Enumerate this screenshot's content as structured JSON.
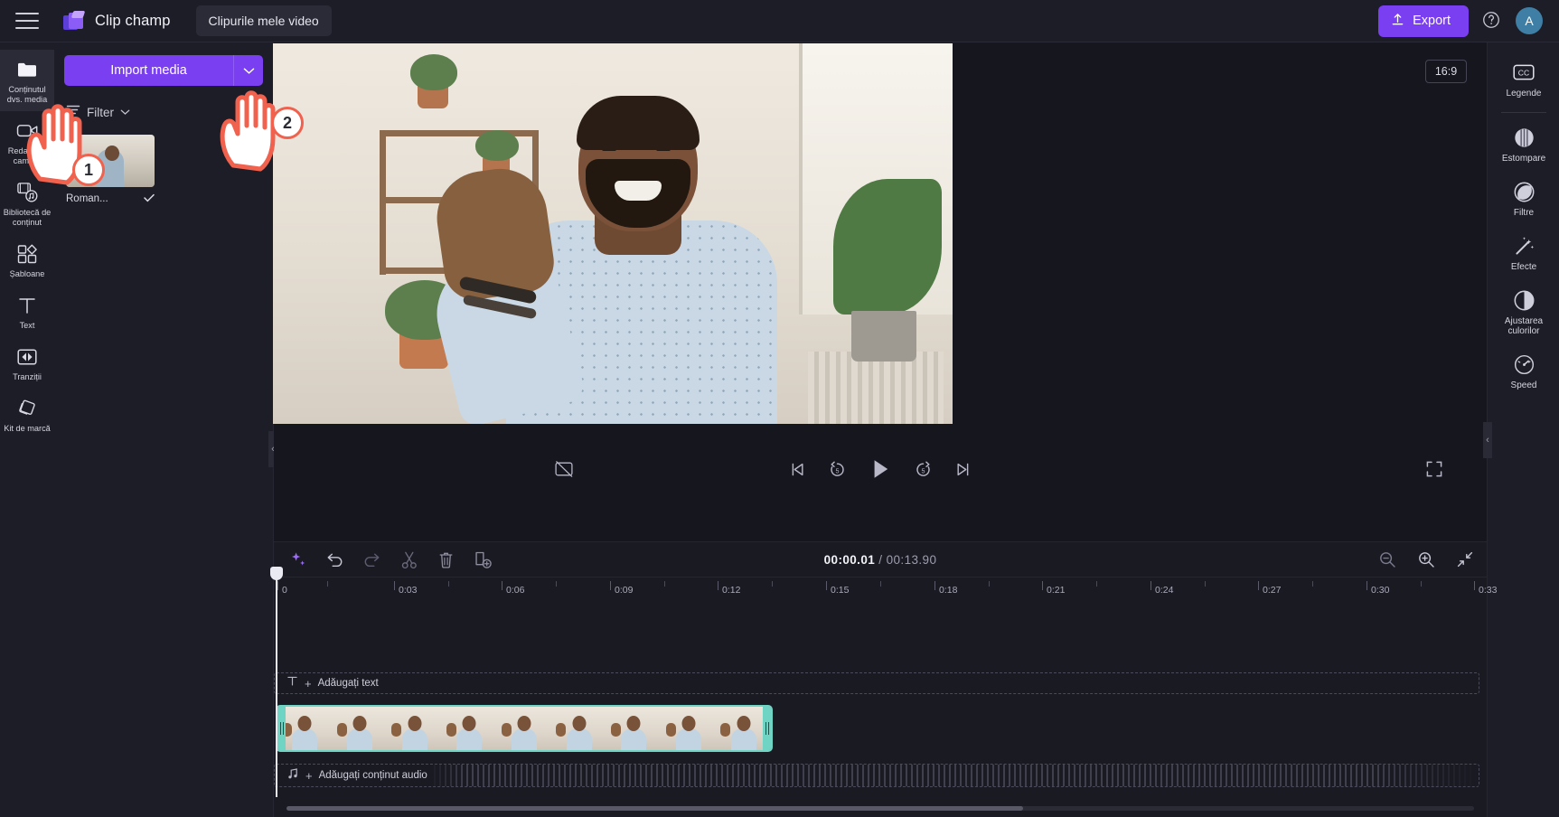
{
  "topbar": {
    "menu_icon": "hamburger-icon",
    "brand_name": "Clip champ",
    "project_tab": "Clipurile mele video",
    "export_label": "Export",
    "export_icon": "upload-icon",
    "help_icon": "help-circle-icon",
    "avatar_initial": "A"
  },
  "left_rail": [
    {
      "label": "Conținutul dvs. media",
      "icon": "folder-icon",
      "active": true
    },
    {
      "label": "Redare cu camera",
      "icon": "camera-record-icon",
      "active": false
    },
    {
      "label": "Bibliotecă de conținut",
      "icon": "content-library-icon",
      "active": false
    },
    {
      "label": "Șabloane",
      "icon": "templates-icon",
      "active": false
    },
    {
      "label": "Text",
      "icon": "text-icon",
      "active": false
    },
    {
      "label": "Tranziții",
      "icon": "transitions-icon",
      "active": false
    },
    {
      "label": "Kit de marcă",
      "icon": "brand-kit-icon",
      "active": false
    }
  ],
  "media_panel": {
    "import_label": "Import media",
    "import_caret_icon": "chevron-down-icon",
    "filter_label": "Filter",
    "filter_icon": "filter-icon",
    "filter_caret_icon": "chevron-down-icon",
    "sort_icon": "sort-arrows-icon",
    "items": [
      {
        "name": "Roman...",
        "selected": true,
        "check_icon": "check-icon"
      }
    ]
  },
  "preview": {
    "ratio_badge": "16:9",
    "controls": {
      "captions_icon": "captions-off-icon",
      "skip_back_icon": "skip-to-start-icon",
      "rewind_icon": "rewind-5s-icon",
      "play_icon": "play-icon",
      "forward_icon": "forward-5s-icon",
      "skip_forward_icon": "skip-to-end-icon",
      "fullscreen_icon": "fullscreen-icon"
    }
  },
  "right_rail": [
    {
      "label": "Legende",
      "icon": "captions-cc-icon"
    },
    {
      "label": "Estompare",
      "icon": "blur-icon"
    },
    {
      "label": "Filtre",
      "icon": "filters-circle-icon"
    },
    {
      "label": "Efecte",
      "icon": "effects-wand-icon"
    },
    {
      "label": "Ajustarea culorilor",
      "icon": "color-adjust-icon",
      "label2": "culorilor"
    },
    {
      "label": "Speed",
      "icon": "speedometer-icon"
    }
  ],
  "timeline": {
    "tools": [
      {
        "name": "ai-sparkle-button",
        "icon": "sparkle-icon"
      },
      {
        "name": "undo-button",
        "icon": "undo-icon"
      },
      {
        "name": "redo-button",
        "icon": "redo-icon"
      },
      {
        "name": "split-button",
        "icon": "scissors-icon"
      },
      {
        "name": "delete-button",
        "icon": "trash-icon"
      },
      {
        "name": "duplicate-button",
        "icon": "duplicate-icon"
      }
    ],
    "current_time": "00:00.01",
    "separator": "/",
    "total_time": "00:13.90",
    "zoom_controls": [
      {
        "name": "zoom-out-button",
        "icon": "zoom-out-icon"
      },
      {
        "name": "zoom-in-button",
        "icon": "zoom-in-icon"
      },
      {
        "name": "fit-to-screen-button",
        "icon": "fit-screen-icon"
      }
    ],
    "ruler_labels": [
      "0",
      "0:03",
      "0:06",
      "0:09",
      "0:12",
      "0:15",
      "0:18",
      "0:21",
      "0:24",
      "0:27",
      "0:30",
      "0:33"
    ],
    "text_track_label": "Adăugați text",
    "text_track_icon": "text-t-icon",
    "audio_track_label": "Adăugați conținut audio",
    "audio_track_icon": "music-note-icon"
  },
  "annotations": [
    {
      "number": "1",
      "target": "media-thumbnail"
    },
    {
      "number": "2",
      "target": "import-media-dropdown"
    }
  ],
  "colors": {
    "accent": "#7b3ff2",
    "panel": "#1d1d27",
    "background": "#16161f",
    "clip_border": "#6fd4c4",
    "annotation": "#f0614e"
  }
}
